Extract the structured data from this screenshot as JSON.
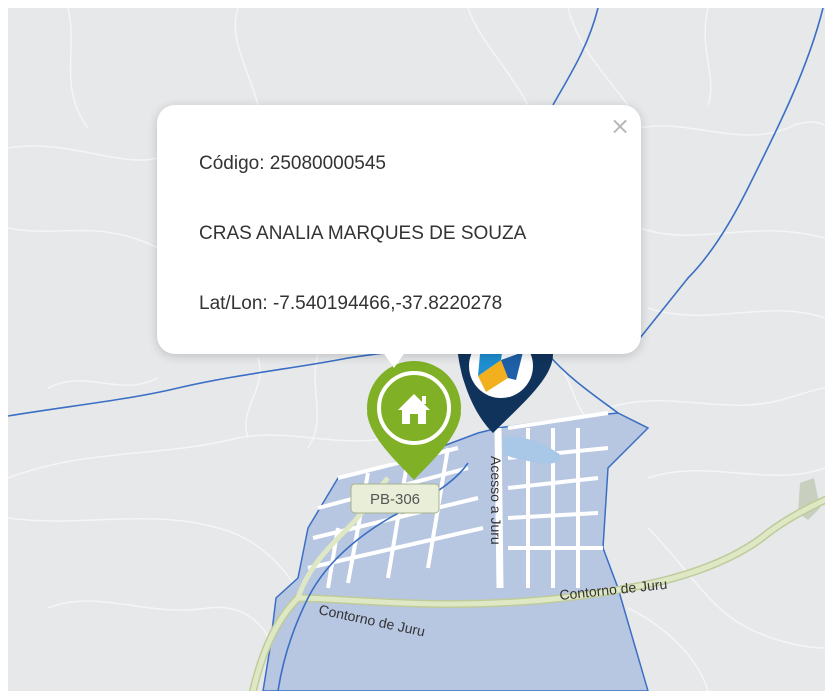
{
  "popup": {
    "code_line": "Código: 25080000545",
    "name_line": "CRAS ANALIA MARQUES DE SOUZA",
    "latlon_line": "Lat/Lon: -7.540194466,-37.8220278",
    "close_glyph": "×"
  },
  "map": {
    "road_shield": "PB-306",
    "street_labels": {
      "acesso": "Acesso a Juru",
      "contorno_left": "Contorno de Juru",
      "contorno_right": "Contorno de Juru"
    }
  },
  "markers": {
    "cras": {
      "icon": "home-icon",
      "color": "#7fb025"
    },
    "agency": {
      "icon": "agency-logo-icon",
      "color": "#10335c"
    }
  },
  "colors": {
    "map_background": "#e6e8ea",
    "boundary_line": "#3b6fc4",
    "municipality_fill": "#aebfdf",
    "highway": "#d6e0b5",
    "roads": "#ffffff"
  }
}
